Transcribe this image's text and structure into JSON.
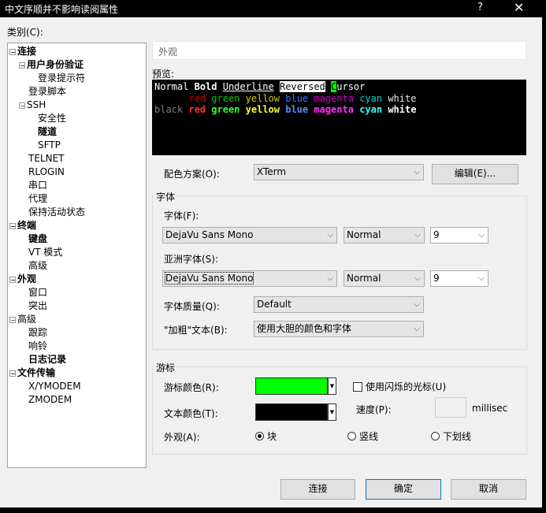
{
  "window": {
    "title": "中文序顺并不影响读阅属性",
    "help": "?",
    "close": "✕"
  },
  "category_label": "类别(C):",
  "tree": [
    {
      "label": "连接",
      "bold": true,
      "indent": 0,
      "expander": "−"
    },
    {
      "label": "用户身份验证",
      "bold": true,
      "indent": 1,
      "expander": "−"
    },
    {
      "label": "登录提示符",
      "bold": false,
      "indent": 2,
      "expander": ""
    },
    {
      "label": "登录脚本",
      "bold": false,
      "indent": 1,
      "expander": ""
    },
    {
      "label": "SSH",
      "bold": false,
      "indent": 1,
      "expander": "−"
    },
    {
      "label": "安全性",
      "bold": false,
      "indent": 2,
      "expander": ""
    },
    {
      "label": "隧道",
      "bold": true,
      "indent": 2,
      "expander": ""
    },
    {
      "label": "SFTP",
      "bold": false,
      "indent": 2,
      "expander": ""
    },
    {
      "label": "TELNET",
      "bold": false,
      "indent": 1,
      "expander": ""
    },
    {
      "label": "RLOGIN",
      "bold": false,
      "indent": 1,
      "expander": ""
    },
    {
      "label": "串口",
      "bold": false,
      "indent": 1,
      "expander": ""
    },
    {
      "label": "代理",
      "bold": false,
      "indent": 1,
      "expander": ""
    },
    {
      "label": "保持活动状态",
      "bold": false,
      "indent": 1,
      "expander": ""
    },
    {
      "label": "终端",
      "bold": true,
      "indent": 0,
      "expander": "−"
    },
    {
      "label": "键盘",
      "bold": true,
      "indent": 1,
      "expander": ""
    },
    {
      "label": "VT 模式",
      "bold": false,
      "indent": 1,
      "expander": ""
    },
    {
      "label": "高级",
      "bold": false,
      "indent": 1,
      "expander": ""
    },
    {
      "label": "外观",
      "bold": true,
      "indent": 0,
      "expander": "−"
    },
    {
      "label": "窗口",
      "bold": false,
      "indent": 1,
      "expander": ""
    },
    {
      "label": "突出",
      "bold": false,
      "indent": 1,
      "expander": ""
    },
    {
      "label": "高级",
      "bold": false,
      "indent": 0,
      "expander": "−"
    },
    {
      "label": "跟踪",
      "bold": false,
      "indent": 1,
      "expander": ""
    },
    {
      "label": "响铃",
      "bold": false,
      "indent": 1,
      "expander": ""
    },
    {
      "label": "日志记录",
      "bold": true,
      "indent": 1,
      "expander": ""
    },
    {
      "label": "文件传输",
      "bold": true,
      "indent": 0,
      "expander": "−"
    },
    {
      "label": "X/YMODEM",
      "bold": false,
      "indent": 1,
      "expander": ""
    },
    {
      "label": "ZMODEM",
      "bold": false,
      "indent": 1,
      "expander": ""
    }
  ],
  "section_title": "外观",
  "preview_label": "预览:",
  "preview": {
    "line1": [
      {
        "t": "Normal ",
        "fg": "#ffffff",
        "bg": "",
        "b": false,
        "u": false
      },
      {
        "t": "Bold",
        "fg": "#ffffff",
        "bg": "",
        "b": true,
        "u": false
      },
      {
        "t": " ",
        "fg": "#ffffff",
        "bg": "",
        "b": false,
        "u": false
      },
      {
        "t": "Underline",
        "fg": "#ffffff",
        "bg": "",
        "b": false,
        "u": true
      },
      {
        "t": " ",
        "fg": "#ffffff",
        "bg": "",
        "b": false,
        "u": false
      },
      {
        "t": "Reversed",
        "fg": "#000000",
        "bg": "#ffffff",
        "b": false,
        "u": false
      },
      {
        "t": " ",
        "fg": "#ffffff",
        "bg": "",
        "b": false,
        "u": false
      },
      {
        "t": "C",
        "fg": "#000000",
        "bg": "#00ff00",
        "b": false,
        "u": false
      },
      {
        "t": "ursor",
        "fg": "#ffffff",
        "bg": "",
        "b": false,
        "u": false
      }
    ],
    "line2": [
      {
        "t": "      ",
        "fg": "#ffffff",
        "bg": "",
        "b": false,
        "u": false
      },
      {
        "t": "red",
        "fg": "#cd0000",
        "bg": "",
        "b": false,
        "u": false
      },
      {
        "t": " ",
        "fg": "#ffffff",
        "bg": "",
        "b": false,
        "u": false
      },
      {
        "t": "green",
        "fg": "#00cd00",
        "bg": "",
        "b": false,
        "u": false
      },
      {
        "t": " ",
        "fg": "#ffffff",
        "bg": "",
        "b": false,
        "u": false
      },
      {
        "t": "yellow",
        "fg": "#cdcd00",
        "bg": "",
        "b": false,
        "u": false
      },
      {
        "t": " ",
        "fg": "#ffffff",
        "bg": "",
        "b": false,
        "u": false
      },
      {
        "t": "blue",
        "fg": "#3b78ff",
        "bg": "",
        "b": false,
        "u": false
      },
      {
        "t": " ",
        "fg": "#ffffff",
        "bg": "",
        "b": false,
        "u": false
      },
      {
        "t": "magenta",
        "fg": "#cd00cd",
        "bg": "",
        "b": false,
        "u": false
      },
      {
        "t": " ",
        "fg": "#ffffff",
        "bg": "",
        "b": false,
        "u": false
      },
      {
        "t": "cyan",
        "fg": "#00cdcd",
        "bg": "",
        "b": false,
        "u": false
      },
      {
        "t": " ",
        "fg": "#ffffff",
        "bg": "",
        "b": false,
        "u": false
      },
      {
        "t": "white",
        "fg": "#e5e5e5",
        "bg": "",
        "b": false,
        "u": false
      }
    ],
    "line3": [
      {
        "t": "black",
        "fg": "#7f7f7f",
        "bg": "",
        "b": false,
        "u": false
      },
      {
        "t": " ",
        "fg": "#ffffff",
        "bg": "",
        "b": false,
        "u": false
      },
      {
        "t": "red",
        "fg": "#ff3030",
        "bg": "",
        "b": true,
        "u": false
      },
      {
        "t": " ",
        "fg": "#ffffff",
        "bg": "",
        "b": false,
        "u": false
      },
      {
        "t": "green",
        "fg": "#30ff30",
        "bg": "",
        "b": true,
        "u": false
      },
      {
        "t": " ",
        "fg": "#ffffff",
        "bg": "",
        "b": false,
        "u": false
      },
      {
        "t": "yellow",
        "fg": "#ffff30",
        "bg": "",
        "b": true,
        "u": false
      },
      {
        "t": " ",
        "fg": "#ffffff",
        "bg": "",
        "b": false,
        "u": false
      },
      {
        "t": "blue",
        "fg": "#5c8cff",
        "bg": "",
        "b": true,
        "u": false
      },
      {
        "t": " ",
        "fg": "#ffffff",
        "bg": "",
        "b": false,
        "u": false
      },
      {
        "t": "magenta",
        "fg": "#ff30ff",
        "bg": "",
        "b": true,
        "u": false
      },
      {
        "t": " ",
        "fg": "#ffffff",
        "bg": "",
        "b": false,
        "u": false
      },
      {
        "t": "cyan",
        "fg": "#30ffff",
        "bg": "",
        "b": true,
        "u": false
      },
      {
        "t": " ",
        "fg": "#ffffff",
        "bg": "",
        "b": false,
        "u": false
      },
      {
        "t": "white",
        "fg": "#ffffff",
        "bg": "",
        "b": true,
        "u": false
      }
    ]
  },
  "color_scheme": {
    "label": "配色方案(O):",
    "value": "XTerm",
    "edit_button": "编辑(E)..."
  },
  "font_group": {
    "title": "字体",
    "font_label": "字体(F):",
    "font_value": "DejaVu Sans Mono",
    "font_style": "Normal",
    "font_size": "9",
    "asian_label": "亚洲字体(S):",
    "asian_value": "DejaVu Sans Mono",
    "asian_style": "Normal",
    "asian_size": "9",
    "quality_label": "字体质量(Q):",
    "quality_value": "Default",
    "bold_label": "\"加粗\"文本(B):",
    "bold_value": "使用大胆的颜色和字体"
  },
  "cursor_group": {
    "title": "游标",
    "cursor_color_label": "游标颜色(R):",
    "cursor_color": "#00ff00",
    "blink_label": "使用闪烁的光标(U)",
    "text_color_label": "文本颜色(T):",
    "text_color": "#000000",
    "speed_label": "速度(P):",
    "speed_unit": "millisec",
    "appearance_label": "外观(A):",
    "options": [
      "块",
      "竖线",
      "下划线"
    ],
    "selected": "块"
  },
  "buttons": {
    "connect": "连接",
    "ok": "确定",
    "cancel": "取消"
  }
}
